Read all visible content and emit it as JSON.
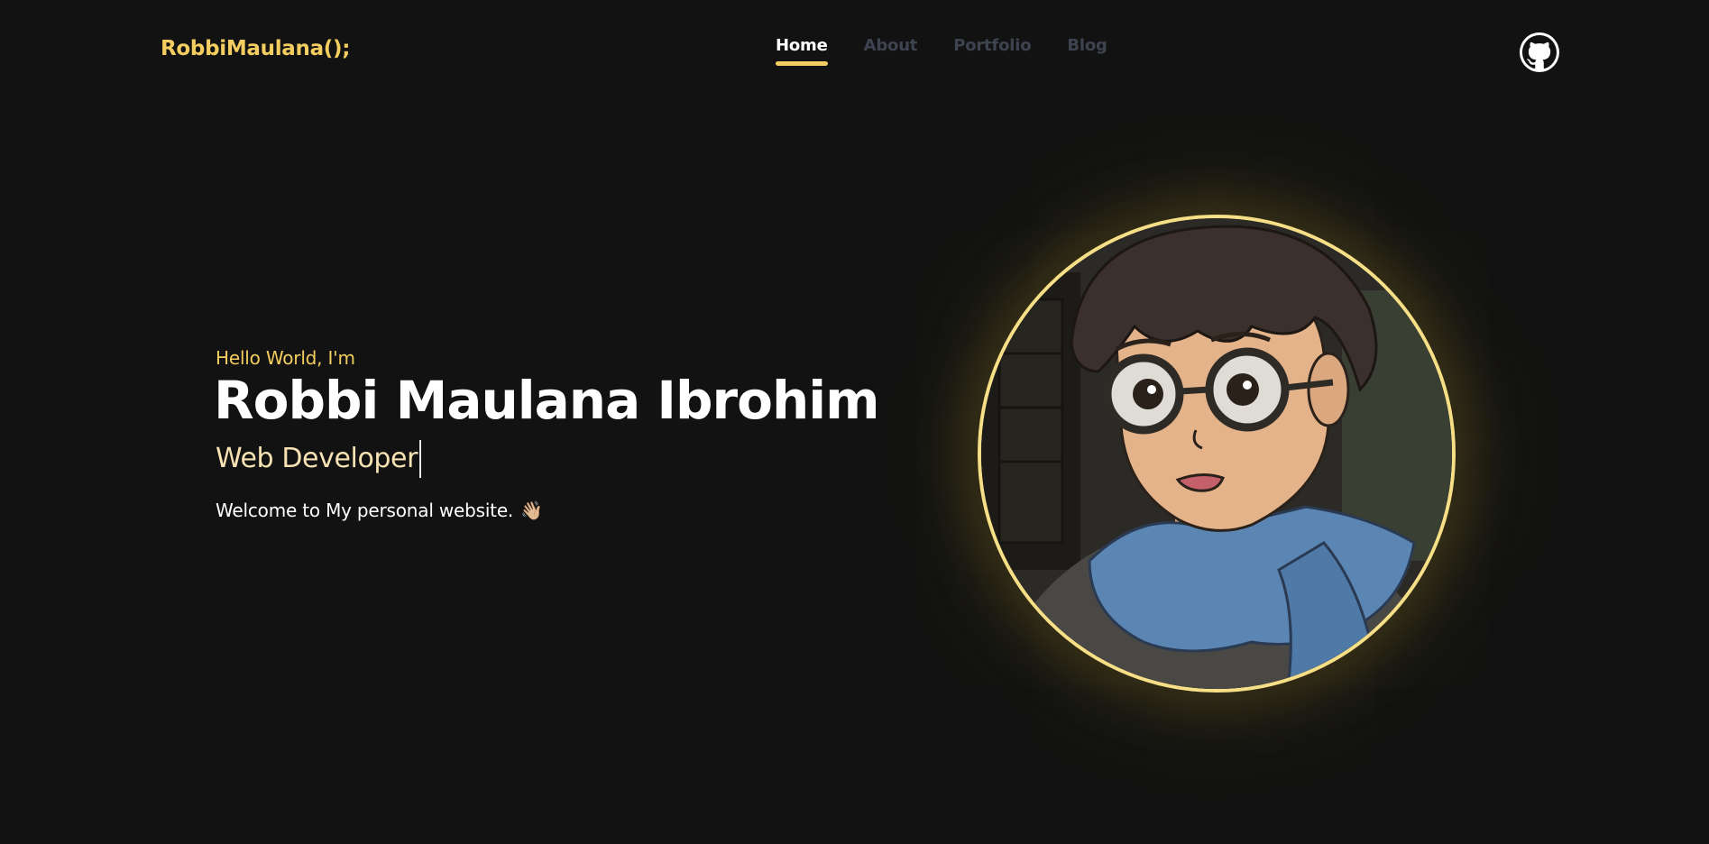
{
  "header": {
    "logo": "RobbiMaulana();",
    "nav": [
      {
        "label": "Home",
        "active": true
      },
      {
        "label": "About",
        "active": false
      },
      {
        "label": "Portfolio",
        "active": false
      },
      {
        "label": "Blog",
        "active": false
      }
    ],
    "github_icon": "github-icon"
  },
  "hero": {
    "greeting": "Hello World, I'm",
    "name": "Robbi Maulana Ibrohim",
    "role": "Web Developer",
    "welcome": "Welcome to My personal website.",
    "wave_emoji": "👋🏼"
  },
  "avatar": {
    "icon": "avatar-illustration"
  },
  "colors": {
    "background": "#121212",
    "accent": "#f3cd5f",
    "nav_inactive": "#3e4350",
    "role": "#f6e2b2",
    "avatar_ring": "#f6df86"
  }
}
